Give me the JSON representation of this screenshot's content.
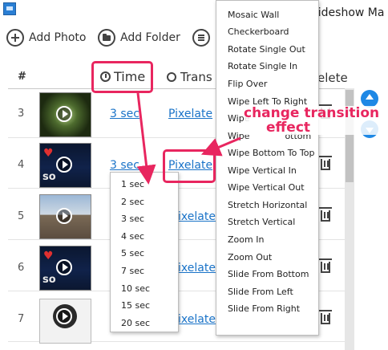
{
  "window": {
    "title": "Slideshow Ma"
  },
  "toolbar": {
    "add_photo": "Add Photo",
    "add_folder": "Add Folder"
  },
  "columns": {
    "num": "#",
    "time": "Time",
    "transition": "Trans",
    "delete": "elete"
  },
  "rows": [
    {
      "num": "3",
      "time": "3 sec",
      "transition": "Pixelate",
      "thumb": "tunnel"
    },
    {
      "num": "4",
      "time": "3 sec",
      "transition": "Pixelate",
      "thumb": "software"
    },
    {
      "num": "5",
      "time": "",
      "transition": "ixelate",
      "thumb": "building"
    },
    {
      "num": "6",
      "time": "",
      "transition": "ixelate",
      "thumb": "software"
    },
    {
      "num": "7",
      "time": "",
      "transition": "ixelate",
      "thumb": "clock"
    }
  ],
  "time_options": [
    "1 sec",
    "2 sec",
    "3 sec",
    "4 sec",
    "5 sec",
    "7 sec",
    "10 sec",
    "15 sec",
    "20 sec"
  ],
  "transition_options": [
    "Mosaic Wall",
    "Checkerboard",
    "Rotate Single Out",
    "Rotate Single In",
    "Flip Over",
    "Wipe Left To Right",
    "Wipe",
    "Wipe",
    "Wipe Bottom To Top",
    "Wipe Vertical In",
    "Wipe Vertical Out",
    "Stretch Horizontal",
    "Stretch Vertical",
    "Zoom In",
    "Zoom Out",
    "Slide From Bottom",
    "Slide From Left",
    "Slide From Right"
  ],
  "transition_partial_suffix": "ottom",
  "annotation": {
    "line1": "change transition",
    "line2": "effect"
  },
  "colors": {
    "accent": "#e8265f",
    "link": "#1a73c8",
    "arrow_button": "#1e88e5"
  }
}
